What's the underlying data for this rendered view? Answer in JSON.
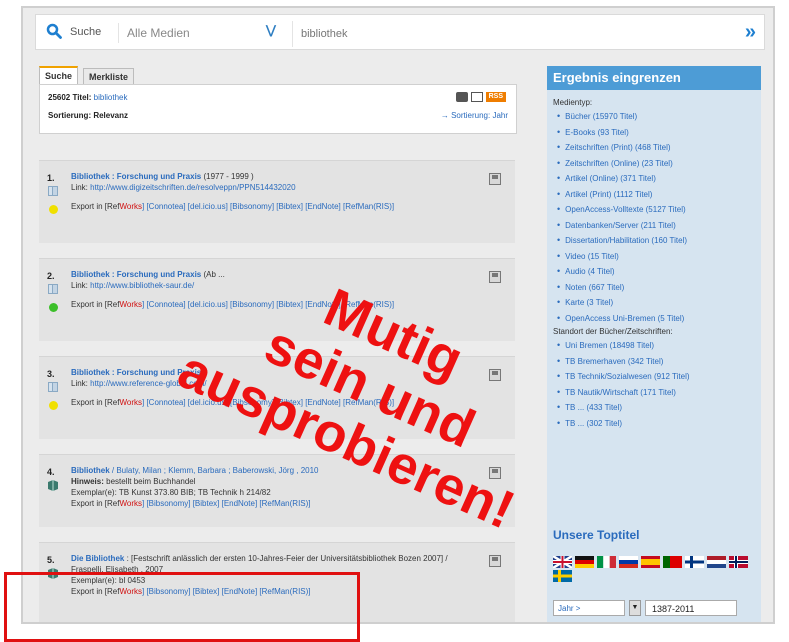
{
  "search": {
    "label": "Suche",
    "media_select": "Alle Medien",
    "query": "bibliothek"
  },
  "tabs": [
    "Suche",
    "Merkliste"
  ],
  "results": {
    "count_label": "25602 Titel:",
    "count_term": "bibliothek",
    "sort_label": "Sortierung: Relevanz",
    "sort_link": "→ Sortierung: Jahr",
    "rss": "RSS"
  },
  "entries": [
    {
      "num": "1.",
      "title": "Bibliothek : Forschung und Praxis",
      "meta": " (1977 - 1999 )",
      "line2_label": "Link: ",
      "line2_value": "http://www.digizeitschriften.de/resolveppn/PPN514432020",
      "export_pre": "Export in [Ref",
      "export_red": "Works",
      "export_rest": "] [Connotea] [del.icio.us] [Bibsonomy] [Bibtex] [EndNote] [RefMan(RIS)]",
      "dot_color": "#f0e000"
    },
    {
      "num": "2.",
      "title": "Bibliothek : Forschung und Praxis",
      "meta": " (Ab ...",
      "line2_label": "Link: ",
      "line2_value": "http://www.bibliothek-saur.de/",
      "export_pre": "Export in [Ref",
      "export_red": "Works",
      "export_rest": "] [Connotea] [del.icio.us] [Bibsonomy] [Bibtex] [EndNote] [RefMan(RIS)]",
      "dot_color": "#3cbf2a"
    },
    {
      "num": "3.",
      "title": "Bibliothek : Forschung und Praxis",
      "meta": "",
      "line2_label": "Link: ",
      "line2_value": "http://www.reference-global.com/",
      "export_pre": "Export in [Ref",
      "export_red": "Works",
      "export_rest": "] [Connotea] [del.icio.us] [Bibsonomy] [Bibtex] [EndNote] [RefMan(RIS)]",
      "dot_color": "#f0e000"
    },
    {
      "num": "4.",
      "title": "Bibliothek",
      "meta": " / Bulaty, Milan ; Klemm, Barbara ; Baberowski, Jörg , 2010",
      "line2_label": "Hinweis: ",
      "line2_value": "bestellt beim Buchhandel",
      "line3": "Exemplar(e): TB Kunst 373.80 BIB; TB Technik h 214/82",
      "export_pre": "Export in [Ref",
      "export_red": "Works",
      "export_rest": "] [Bibsonomy] [Bibtex] [EndNote] [RefMan(RIS)]",
      "dot_color": ""
    },
    {
      "num": "5.",
      "title": "Die Bibliothek",
      "meta": " : [Festschrift anlässlich der ersten 10-Jahres-Feier der Universitätsbibliothek Bozen 2007] / Fraspelli, Elisabeth , 2007",
      "line2_label": "",
      "line2_value": "",
      "line3": "Exemplar(e): bl 0453",
      "export_pre": "Export in [Ref",
      "export_red": "Works",
      "export_rest": "] [Bibsonomy] [Bibtex] [EndNote] [RefMan(RIS)]",
      "dot_color": ""
    }
  ],
  "sidebar": {
    "title": "Ergebnis eingrenzen",
    "medientyp_label": "Medientyp:",
    "medientyp": [
      "Bücher (15970 Titel)",
      "E-Books (93 Titel)",
      "Zeitschriften (Print) (468 Titel)",
      "Zeitschriften (Online) (23 Titel)",
      "Artikel (Online) (371 Titel)",
      "Artikel (Print) (1112 Titel)",
      "OpenAccess-Volltexte (5127 Titel)",
      "Datenbanken/Server (211 Titel)",
      "Dissertation/Habilitation (160 Titel)",
      "Video (15 Titel)",
      "Audio (4 Titel)",
      "Noten (667 Titel)",
      "Karte (3 Titel)",
      "OpenAccess Uni-Bremen (5 Titel)"
    ],
    "standort_label": "Standort der Bücher/Zeitschriften:",
    "standort": [
      "Uni Bremen (18498 Titel)",
      "TB Bremerhaven (342 Titel)",
      "TB Technik/Sozialwesen (912 Titel)",
      "TB Nautik/Wirtschaft (171 Titel)",
      "TB ... (433 Titel)",
      "TB ... (302 Titel)"
    ],
    "toptitel": "Unsere Toptitel",
    "jahr_select": "Jahr >",
    "jahr_value": "1387-2011"
  },
  "overlay": {
    "line1": "Mutig",
    "line2": "sein und",
    "line3": "ausprobieren!"
  },
  "colors": {
    "accent_blue": "#4d9cd6",
    "link": "#2a6bbd",
    "overlay_red": "#ee1111"
  }
}
